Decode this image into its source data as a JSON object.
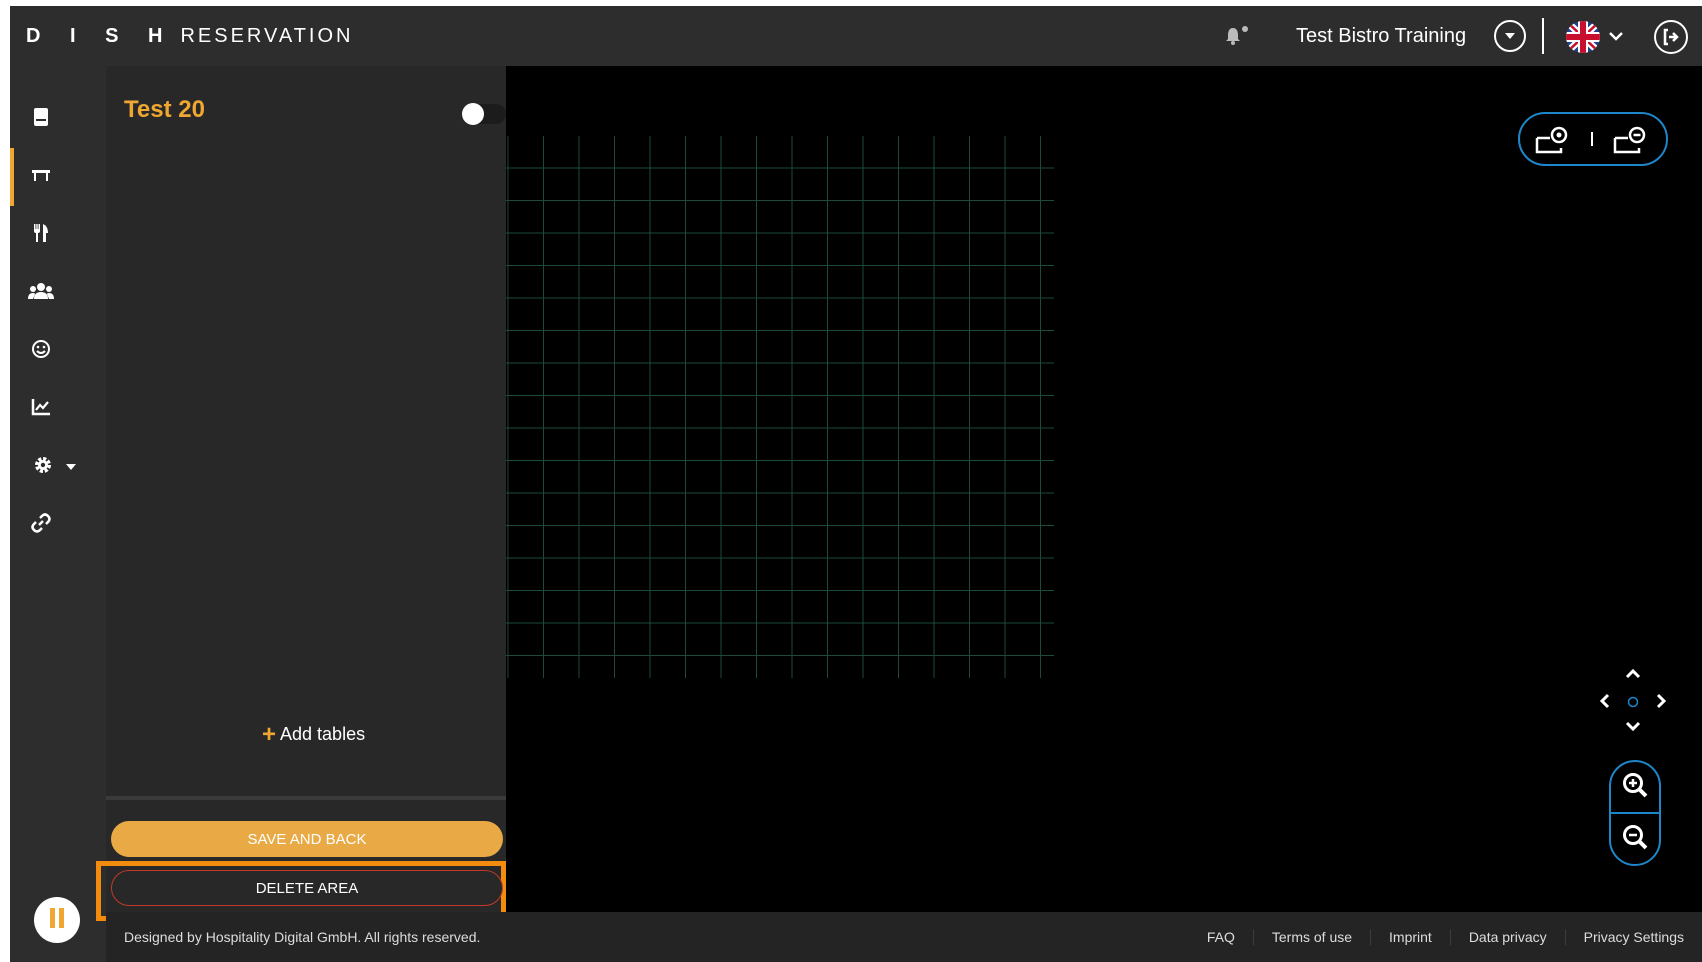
{
  "header": {
    "brand_dish": "D I S H",
    "brand_reservation": "RESERVATION",
    "restaurant_name": "Test Bistro Training",
    "icons": {
      "bell": "bell-icon",
      "restaurant_dropdown": "chevron-down-circle-icon",
      "language": "uk-flag-icon",
      "language_dropdown": "chevron-down-icon",
      "logout": "logout-icon"
    }
  },
  "sidebar": {
    "items": [
      {
        "icon": "book-icon",
        "active": false
      },
      {
        "icon": "table-icon",
        "active": true
      },
      {
        "icon": "cutlery-icon",
        "active": false
      },
      {
        "icon": "users-icon",
        "active": false
      },
      {
        "icon": "smiley-icon",
        "active": false
      },
      {
        "icon": "chart-icon",
        "active": false
      },
      {
        "icon": "gear-icon",
        "active": false
      },
      {
        "icon": "link-icon",
        "active": false
      }
    ],
    "pause_icon": "pause-icon"
  },
  "panel": {
    "area_name": "Test 20",
    "toggle_on": false,
    "add_tables_label": "Add tables",
    "save_label": "SAVE AND BACK",
    "delete_label": "DELETE AREA"
  },
  "canvas": {
    "icons": {
      "view_left": "floor-plan-icon",
      "view_right": "floor-plan-alt-icon",
      "pan_up": "chevron-up-icon",
      "pan_left": "chevron-left-icon",
      "pan_right": "chevron-right-icon",
      "pan_down": "chevron-down-icon",
      "pan_center": "circle-icon",
      "zoom_in": "zoom-in-icon",
      "zoom_out": "zoom-out-icon"
    }
  },
  "footer": {
    "copyright": "Designed by Hospitality Digital GmbH. All rights reserved.",
    "links": [
      "FAQ",
      "Terms of use",
      "Imprint",
      "Data privacy",
      "Privacy Settings"
    ]
  },
  "colors": {
    "accent": "#f0a732",
    "highlight": "#f28c0f",
    "canvas_control": "#1e86c9",
    "grid_line": "#1d4a3c"
  }
}
